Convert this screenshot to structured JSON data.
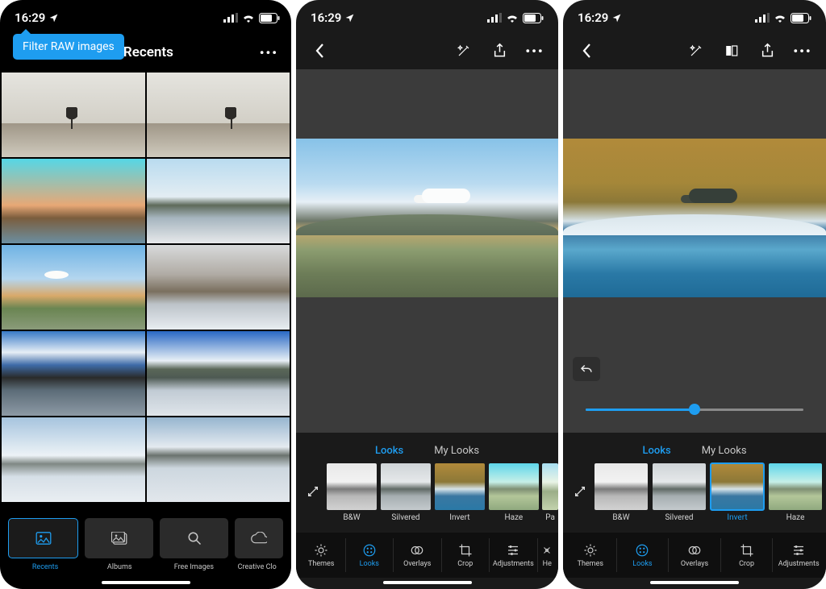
{
  "status": {
    "time": "16:29"
  },
  "screen1": {
    "tooltip": "Filter RAW images",
    "title": "Recents",
    "nav": {
      "recents": "Recents",
      "albums": "Albums",
      "free": "Free Images",
      "cloud": "Creative Clo"
    }
  },
  "looks_tabs": {
    "looks": "Looks",
    "mylooks": "My Looks"
  },
  "looks": {
    "bw": "B&W",
    "silvered": "Silvered",
    "invert": "Invert",
    "haze": "Haze",
    "pa": "Pa"
  },
  "tools": {
    "themes": "Themes",
    "looks": "Looks",
    "overlays": "Overlays",
    "crop": "Crop",
    "adjustments": "Adjustments",
    "he": "He"
  },
  "slider": {
    "value": 50
  }
}
